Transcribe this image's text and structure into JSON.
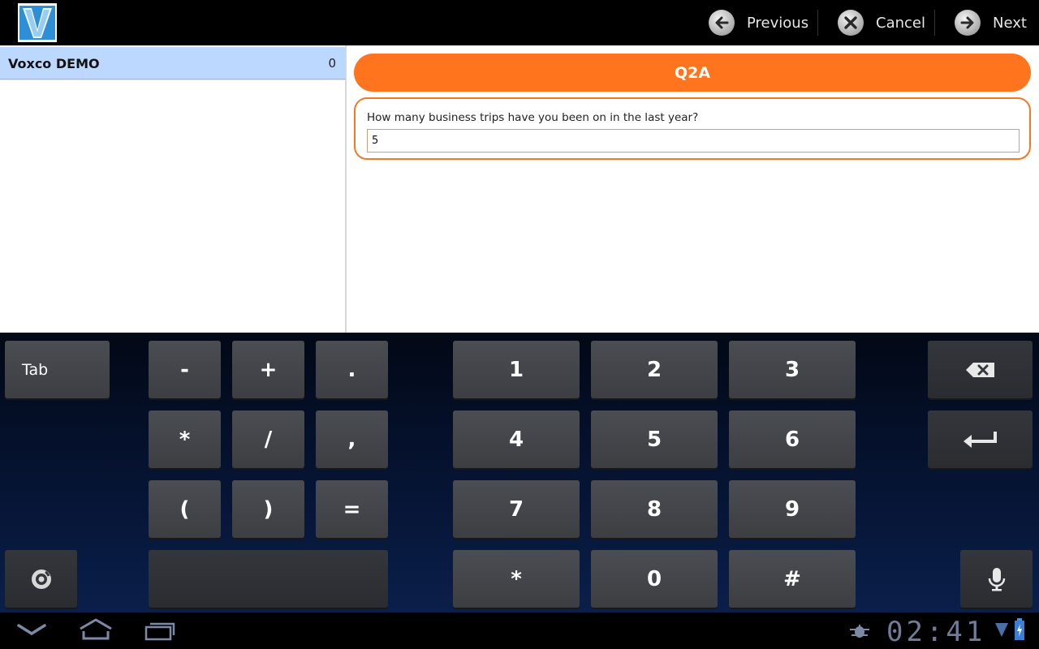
{
  "app": {
    "actions": {
      "previous": "Previous",
      "cancel": "Cancel",
      "next": "Next"
    }
  },
  "sidebar": {
    "items": [
      {
        "label": "Voxco DEMO",
        "count": "0"
      }
    ]
  },
  "question": {
    "id": "Q2A",
    "text": "How many business trips have you been on in the last year?",
    "answer": "5"
  },
  "keyboard": {
    "tab": "Tab",
    "symbols": [
      "-",
      "+",
      ".",
      "*",
      "/",
      ",",
      "(",
      ")",
      "="
    ],
    "digits": [
      "1",
      "2",
      "3",
      "4",
      "5",
      "6",
      "7",
      "8",
      "9",
      "*",
      "0",
      "#"
    ]
  },
  "status": {
    "time": "02:41"
  },
  "colors": {
    "accent": "#ff741d",
    "selected_row": "#bcd8ff"
  }
}
